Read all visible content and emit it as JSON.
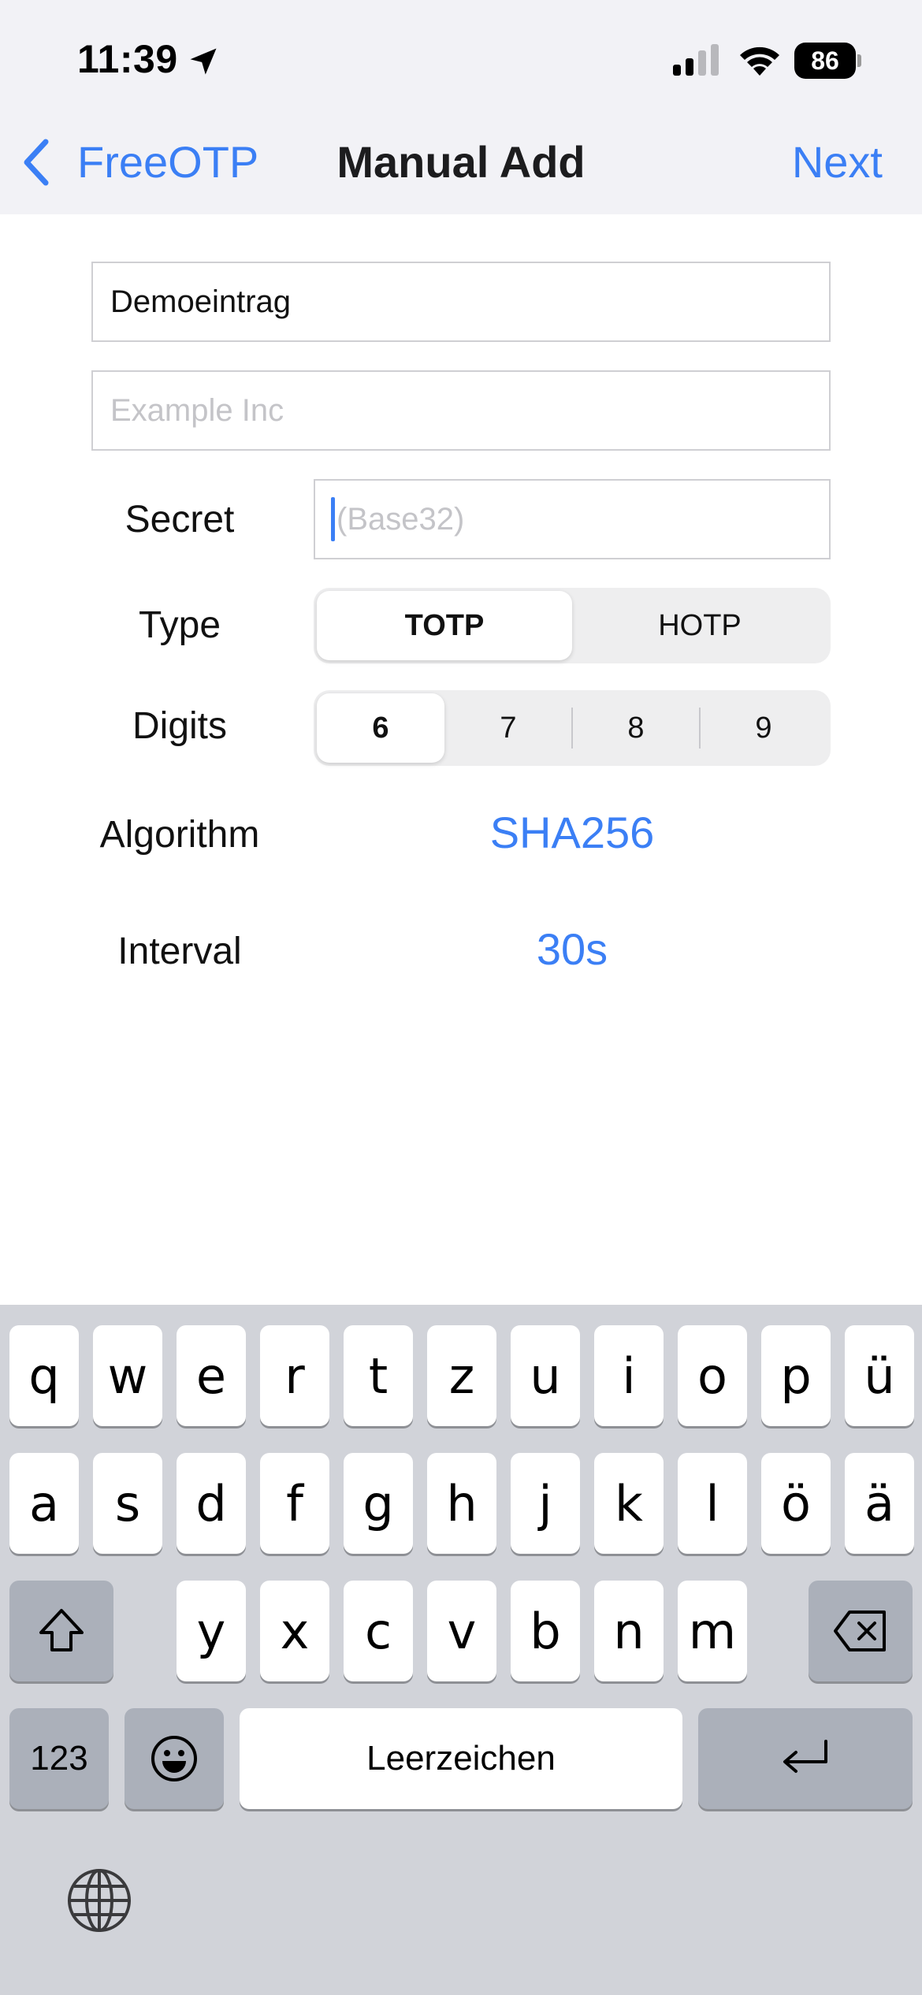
{
  "status_bar": {
    "time": "11:39",
    "battery": "86"
  },
  "nav": {
    "back_label": "FreeOTP",
    "title": "Manual Add",
    "next_label": "Next"
  },
  "form": {
    "name_value": "Demoeintrag",
    "issuer_placeholder": "Example Inc",
    "secret_label": "Secret",
    "secret_placeholder": "(Base32)",
    "type_label": "Type",
    "type_options": [
      "TOTP",
      "HOTP"
    ],
    "type_selected": "TOTP",
    "digits_label": "Digits",
    "digits_options": [
      "6",
      "7",
      "8",
      "9"
    ],
    "digits_selected": "6",
    "algorithm_label": "Algorithm",
    "algorithm_value": "SHA256",
    "interval_label": "Interval",
    "interval_value": "30s"
  },
  "keyboard": {
    "row1": [
      "q",
      "w",
      "e",
      "r",
      "t",
      "z",
      "u",
      "i",
      "o",
      "p",
      "ü"
    ],
    "row2": [
      "a",
      "s",
      "d",
      "f",
      "g",
      "h",
      "j",
      "k",
      "l",
      "ö",
      "ä"
    ],
    "row3": [
      "y",
      "x",
      "c",
      "v",
      "b",
      "n",
      "m"
    ],
    "numbers_label": "123",
    "space_label": "Leerzeichen"
  },
  "colors": {
    "accent": "#3b7ff5",
    "nav_bg": "#f2f2f6",
    "keyboard_bg": "#d1d3d9"
  }
}
